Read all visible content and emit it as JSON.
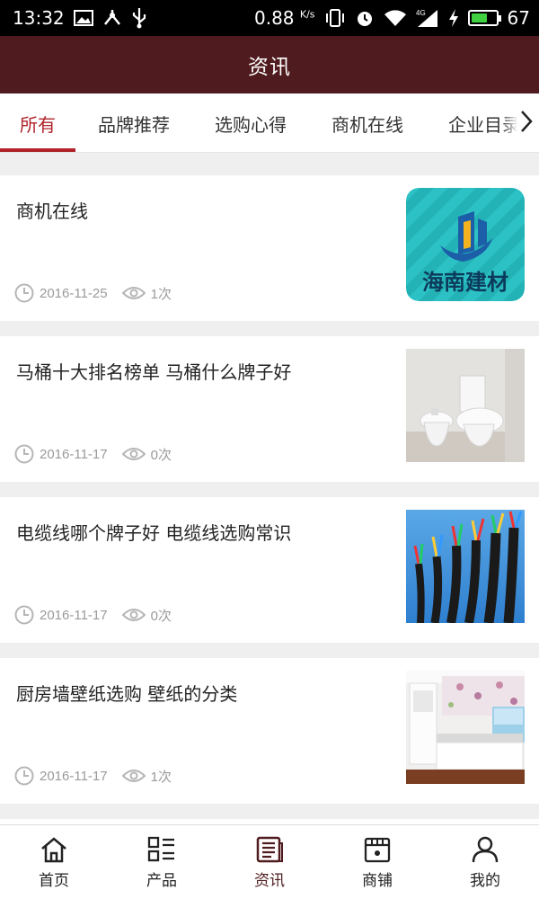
{
  "status_bar": {
    "time": "13:32",
    "net_speed": "0.88",
    "net_unit": "K/s",
    "network_type": "4G",
    "battery": "67",
    "battery_level": 0.67,
    "battery_color": "#3fd13f"
  },
  "header": {
    "title": "资讯",
    "background": "#4f1b1e"
  },
  "tabs": [
    {
      "label": "所有",
      "active": true
    },
    {
      "label": "品牌推荐",
      "active": false
    },
    {
      "label": "选购心得",
      "active": false
    },
    {
      "label": "商机在线",
      "active": false
    },
    {
      "label": "企业目录",
      "active": false
    }
  ],
  "accent_color": "#b0232a",
  "articles": [
    {
      "title": "商机在线",
      "date": "2016-11-25",
      "views": "1次",
      "thumb_text": "海南建材",
      "thumb": "logo"
    },
    {
      "title": "马桶十大排名榜单 马桶什么牌子好",
      "date": "2016-11-17",
      "views": "0次",
      "thumb": "toilet"
    },
    {
      "title": "电缆线哪个牌子好 电缆线选购常识",
      "date": "2016-11-17",
      "views": "0次",
      "thumb": "cables"
    },
    {
      "title": "厨房墙壁纸选购 壁纸的分类",
      "date": "2016-11-17",
      "views": "1次",
      "thumb": "kitchen"
    }
  ],
  "bottom_nav": [
    {
      "label": "首页",
      "icon": "home-icon",
      "active": false
    },
    {
      "label": "产品",
      "icon": "grid-list-icon",
      "active": false
    },
    {
      "label": "资讯",
      "icon": "news-icon",
      "active": true
    },
    {
      "label": "商铺",
      "icon": "shop-icon",
      "active": false
    },
    {
      "label": "我的",
      "icon": "user-icon",
      "active": false
    }
  ]
}
